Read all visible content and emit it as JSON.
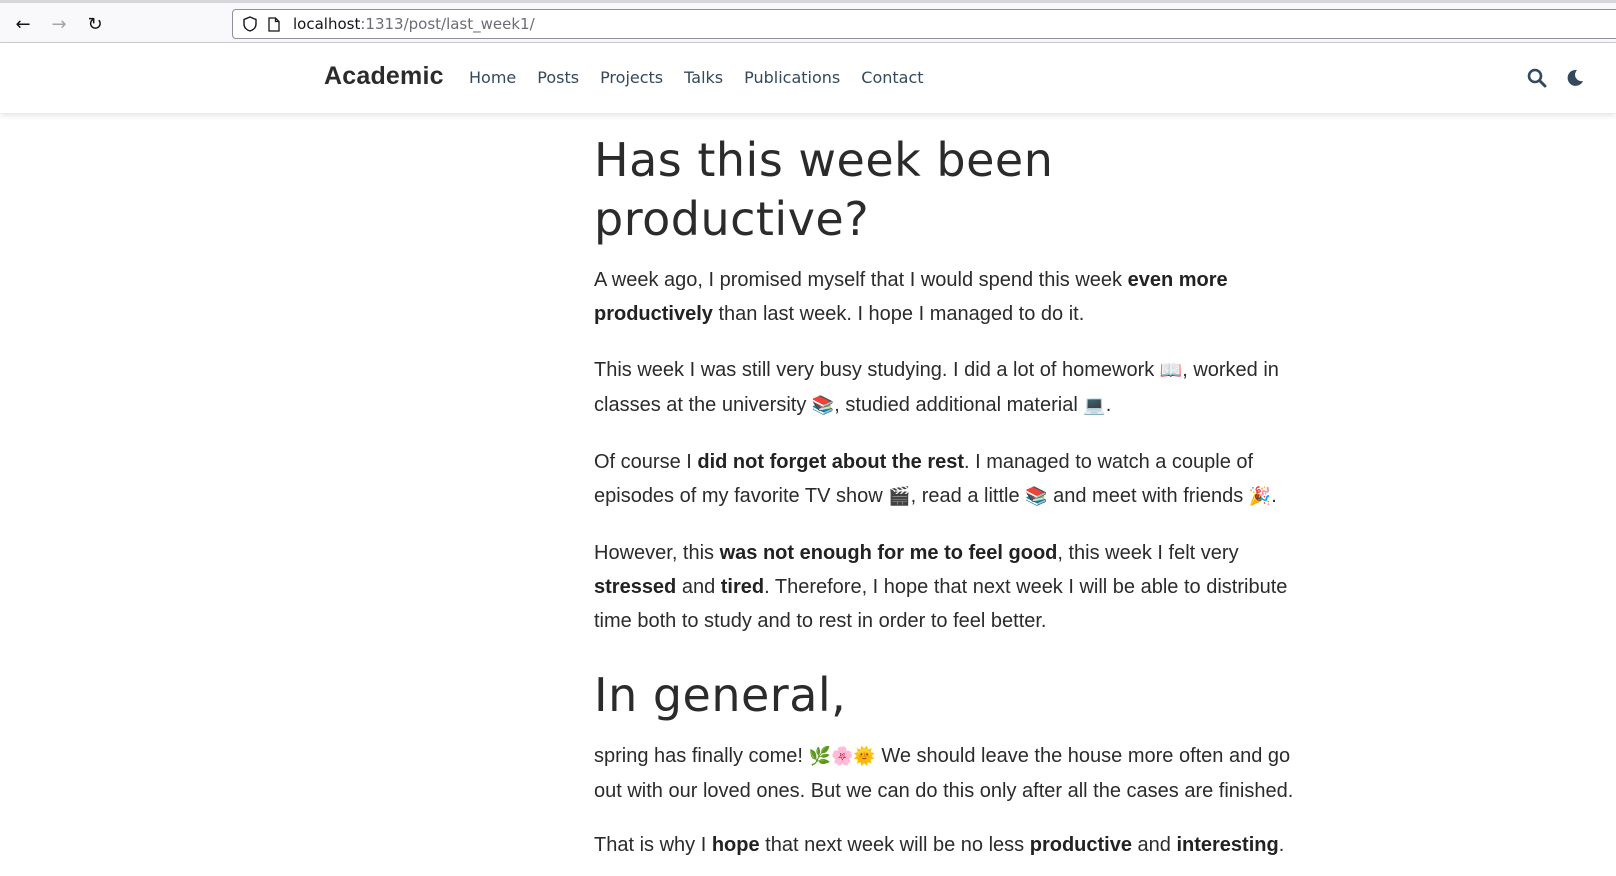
{
  "browser": {
    "back_icon": "←",
    "forward_icon": "→",
    "reload_icon": "↻",
    "url_host": "localhost",
    "url_path": ":1313/post/last_week1/"
  },
  "navbar": {
    "brand": "Academic",
    "menu": [
      "Home",
      "Posts",
      "Projects",
      "Talks",
      "Publications",
      "Contact"
    ],
    "icons": [
      "search-icon",
      "moon-icon"
    ],
    "link_color": "#34495e"
  },
  "article": {
    "title": "Has this week been productive?",
    "p1": {
      "a": "A week ago, I promised myself that I would spend this week ",
      "b": "even more productively",
      "c": " than last week. I hope I managed to do it."
    },
    "p2": {
      "a": "This week I was still very busy studying. I did a lot of homework ",
      "e1": "📖",
      "b": ", worked in classes at the university ",
      "e2": "📚",
      "c": ", studied additional material ",
      "e3": "💻",
      "d": "."
    },
    "p3": {
      "a": "Of course I ",
      "b": "did not forget about the rest",
      "c": ". I managed to watch a couple of episodes of my favorite TV show ",
      "e1": "🎬",
      "d": ", read a little ",
      "e2": "📚",
      "e": " and meet with friends ",
      "e3": "🎉",
      "f": "."
    },
    "p4": {
      "a": "However, this ",
      "b": "was not enough for me to feel good",
      "c": ", this week I felt very ",
      "d": "stressed",
      "e": " and ",
      "f": "tired",
      "g": ". Therefore, I hope that next week I will be able to distribute time both to study and to rest in order to feel better."
    },
    "heading2": "In general,",
    "p5": {
      "a": "spring has finally come! ",
      "e1": "🌿🌸🌞",
      "b": " We should leave the house more often and go out with our loved ones. But we can do this only after all the cases are finished."
    },
    "p6": {
      "a": "That is why I ",
      "b": "hope",
      "c": " that next week will be no less ",
      "d": "productive",
      "e": " and ",
      "f": "interesting",
      "g": "."
    }
  }
}
